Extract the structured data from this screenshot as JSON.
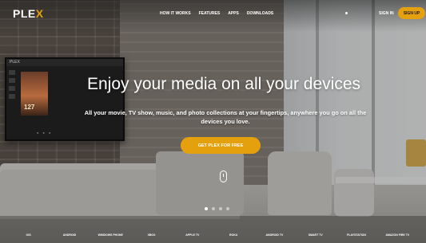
{
  "header": {
    "logo_text_main": "PLE",
    "logo_text_accent": "X",
    "nav": [
      "HOW IT WORKS",
      "FEATURES",
      "APPS",
      "DOWNLOADS"
    ],
    "sign_in": "SIGN IN",
    "sign_up": "SIGN UP"
  },
  "hero": {
    "title": "Enjoy your media on all your devices",
    "subtitle": "All your movie, TV show, music, and photo collections at your fingertips, anywhere you go on all the devices you love.",
    "cta": "GET PLEX FOR FREE"
  },
  "tv": {
    "brand": "PLEX",
    "poster_text": "127"
  },
  "carousel": {
    "count": 4,
    "active": 0
  },
  "platforms": [
    {
      "icon": "apple-icon",
      "glyph": "",
      "label": "iOS"
    },
    {
      "icon": "android-icon",
      "glyph": "",
      "label": "ANDROID"
    },
    {
      "icon": "windows-phone-icon",
      "glyph": "",
      "label": "WINDOWS PHONE"
    },
    {
      "icon": "xbox-icon",
      "glyph": "",
      "label": "XBOX"
    },
    {
      "icon": "apple-tv-icon",
      "glyph": "",
      "label": "APPLE TV"
    },
    {
      "icon": "roku-icon",
      "glyph": "",
      "label": "ROKU"
    },
    {
      "icon": "android-tv-icon",
      "glyph": "",
      "label": "ANDROID TV"
    },
    {
      "icon": "smart-tv-icon",
      "glyph": "",
      "label": "SMART TV"
    },
    {
      "icon": "playstation-icon",
      "glyph": "",
      "label": "PLAYSTATION"
    },
    {
      "icon": "amazon-fire-icon",
      "glyph": "",
      "label": "AMAZON FIRE TV"
    }
  ],
  "colors": {
    "accent": "#e5a00d"
  }
}
